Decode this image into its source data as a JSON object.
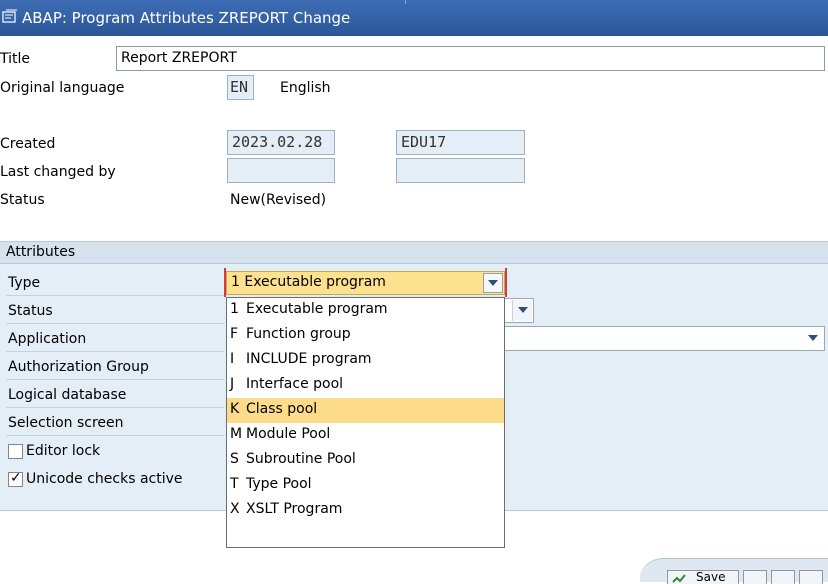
{
  "window": {
    "title": "ABAP: Program Attributes ZREPORT Change"
  },
  "header": {
    "title_label": "Title",
    "title_value": "Report ZREPORT",
    "orig_lang_label": "Original language",
    "orig_lang_code": "EN",
    "orig_lang_name": "English",
    "created_label": "Created",
    "created_date": "2023.02.28",
    "created_user": "EDU17",
    "last_changed_label": "Last changed by",
    "last_changed_date": "",
    "last_changed_user": "",
    "status_label": "Status",
    "status_value": "New(Revised)"
  },
  "attributes": {
    "section_title": "Attributes",
    "type_label": "Type",
    "type_value": "1 Executable program",
    "status_label": "Status",
    "application_label": "Application",
    "auth_group_label": "Authorization Group",
    "logical_db_label": "Logical database",
    "selection_screen_label": "Selection screen",
    "editor_lock_label": "Editor lock",
    "editor_lock_checked": false,
    "unicode_label": "Unicode checks active",
    "unicode_checked": true
  },
  "type_dropdown": {
    "options": [
      {
        "key": "1",
        "label": "Executable program"
      },
      {
        "key": "F",
        "label": "Function group"
      },
      {
        "key": "I",
        "label": "INCLUDE program"
      },
      {
        "key": "J",
        "label": "Interface pool"
      },
      {
        "key": "K",
        "label": "Class pool"
      },
      {
        "key": "M",
        "label": "Module Pool"
      },
      {
        "key": "S",
        "label": "Subroutine Pool"
      },
      {
        "key": "T",
        "label": "Type Pool"
      },
      {
        "key": "X",
        "label": "XSLT Program"
      }
    ],
    "highlighted_key": "K"
  },
  "footer": {
    "save_label": "Save"
  },
  "colors": {
    "titlebar": "#2b5797",
    "highlight": "#fcdc8a",
    "section_bg": "#e4eef6"
  }
}
